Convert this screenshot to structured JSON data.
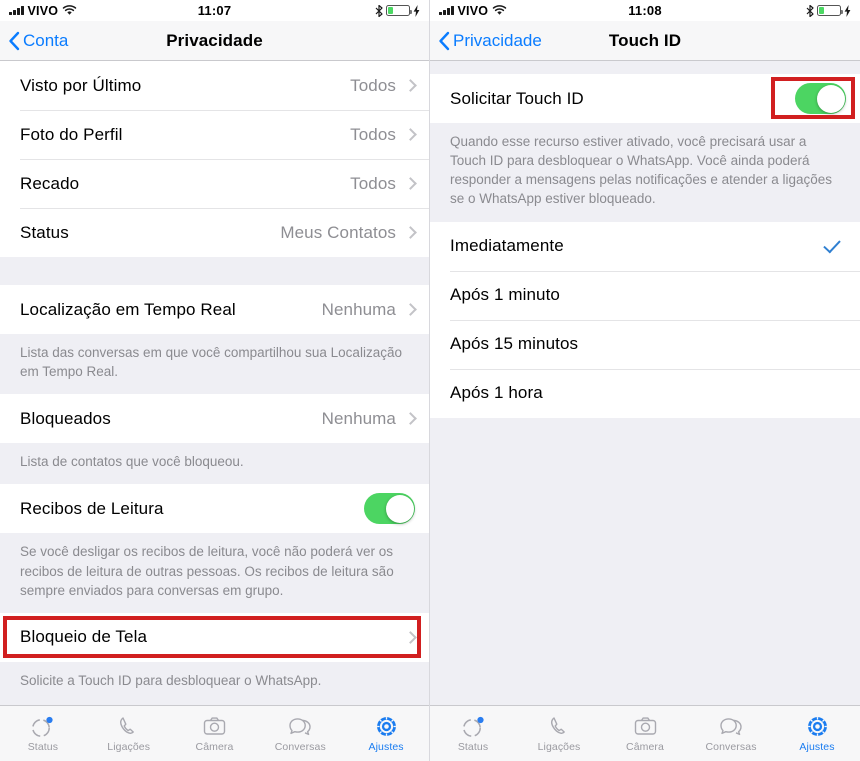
{
  "status_bar": {
    "carrier": "VIVO",
    "signal_icon": "cellular-bars-icon",
    "wifi_icon": "wifi-icon",
    "bluetooth_icon": "bluetooth-icon",
    "battery_icon": "battery-icon",
    "charging_icon": "lightning-bolt-icon",
    "time_left": "11:07",
    "time_right": "11:08"
  },
  "colors": {
    "accent_blue": "#0a7cff",
    "toggle_green": "#4cd562",
    "highlight_red": "#d11f20",
    "check_blue": "#2f7fd1",
    "group_bg": "#efeff4",
    "secondary_text": "#8e8e93"
  },
  "left_screen": {
    "nav": {
      "back_label": "Conta",
      "back_icon": "chevron-left-icon",
      "title": "Privacidade"
    },
    "rows_group_1": [
      {
        "label": "Visto por Último",
        "value": "Todos"
      },
      {
        "label": "Foto do Perfil",
        "value": "Todos"
      },
      {
        "label": "Recado",
        "value": "Todos"
      },
      {
        "label": "Status",
        "value": "Meus Contatos"
      }
    ],
    "live_location": {
      "label": "Localização em Tempo Real",
      "value": "Nenhuma"
    },
    "live_location_footnote": "Lista das conversas em que você compartilhou sua Localização em Tempo Real.",
    "blocked": {
      "label": "Bloqueados",
      "value": "Nenhuma"
    },
    "blocked_footnote": "Lista de contatos que você bloqueou.",
    "read_receipts": {
      "label": "Recibos de Leitura",
      "toggle": "on"
    },
    "read_receipts_footnote": "Se você desligar os recibos de leitura, você não poderá ver os recibos de leitura de outras pessoas. Os recibos de leitura são sempre enviados para conversas em grupo.",
    "screen_lock": {
      "label": "Bloqueio de Tela",
      "highlighted": true
    },
    "screen_lock_footnote": "Solicite a Touch ID para desbloquear o WhatsApp."
  },
  "right_screen": {
    "nav": {
      "back_label": "Privacidade",
      "back_icon": "chevron-left-icon",
      "title": "Touch ID"
    },
    "require_touch_id": {
      "label": "Solicitar Touch ID",
      "toggle": "on",
      "highlighted": true
    },
    "require_footnote": "Quando esse recurso estiver ativado, você precisará usar a Touch ID para desbloquear o WhatsApp. Você ainda poderá responder a mensagens pelas notificações e atender a ligações se o WhatsApp estiver bloqueado.",
    "timing_options": [
      {
        "label": "Imediatamente",
        "selected": true
      },
      {
        "label": "Após 1 minuto",
        "selected": false
      },
      {
        "label": "Após 15 minutos",
        "selected": false
      },
      {
        "label": "Após 1 hora",
        "selected": false
      }
    ]
  },
  "tab_bar": {
    "items": [
      {
        "label": "Status",
        "icon": "status-ring-icon",
        "active": false,
        "badge": true
      },
      {
        "label": "Ligações",
        "icon": "phone-icon",
        "active": false,
        "badge": false
      },
      {
        "label": "Câmera",
        "icon": "camera-icon",
        "active": false,
        "badge": false
      },
      {
        "label": "Conversas",
        "icon": "chat-bubbles-icon",
        "active": false,
        "badge": false
      },
      {
        "label": "Ajustes",
        "icon": "gear-icon",
        "active": true,
        "badge": false
      }
    ]
  }
}
